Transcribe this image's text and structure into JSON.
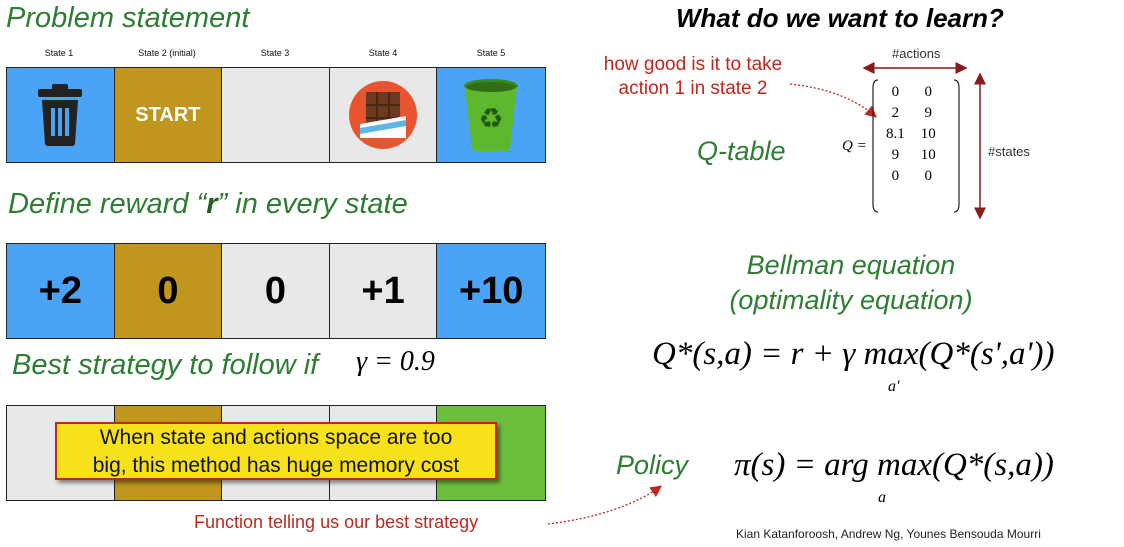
{
  "left": {
    "problem_title": "Problem statement",
    "states": [
      {
        "label": "State 1",
        "content": "trash-icon"
      },
      {
        "label": "State 2 (initial)",
        "content": "START"
      },
      {
        "label": "State 3",
        "content": ""
      },
      {
        "label": "State 4",
        "content": "chocolate-icon"
      },
      {
        "label": "State 5",
        "content": "recycle-bin-icon"
      }
    ],
    "reward_title_pre": "Define reward “",
    "reward_title_r": "r",
    "reward_title_post": "” in every state",
    "rewards": [
      "+2",
      "0",
      "0",
      "+1",
      "+10"
    ],
    "strategy_title": "Best strategy to follow if",
    "gamma_eq": "γ = 0.9",
    "callout_line1": "When state and actions space are too",
    "callout_line2": "big, this method has huge memory cost",
    "function_note": "Function telling us our best strategy"
  },
  "right": {
    "heading": "What do we want to learn?",
    "annotation_line1": "how good is it to take",
    "annotation_line2": "action 1 in state 2",
    "actions_label": "#actions",
    "states_label": "#states",
    "qtable_label": "Q-table",
    "q_eq": "Q =",
    "q_matrix": [
      [
        "0",
        "0"
      ],
      [
        "2",
        "9"
      ],
      [
        "8.1",
        "10"
      ],
      [
        "9",
        "10"
      ],
      [
        "0",
        "0"
      ]
    ],
    "bellman_line1": "Bellman equation",
    "bellman_line2": "(optimality equation)",
    "bellman_formula": "Q*(s,a) = r + γ max(Q*(s',a'))",
    "bellman_sub": "a'",
    "policy_label": "Policy",
    "policy_formula": "π(s) = arg max(Q*(s,a))",
    "policy_sub": "a",
    "credits": "Kian Katanforoosh, Andrew Ng, Younes Bensouda Mourri"
  },
  "colors": {
    "blue": "#4aa3f5",
    "gold": "#c0961e",
    "grey": "#e8e8e8",
    "green": "#6cbf3c",
    "title_green": "#2e7d32",
    "annotation_red": "#c0271f",
    "callout_yellow": "#f7e11a"
  }
}
